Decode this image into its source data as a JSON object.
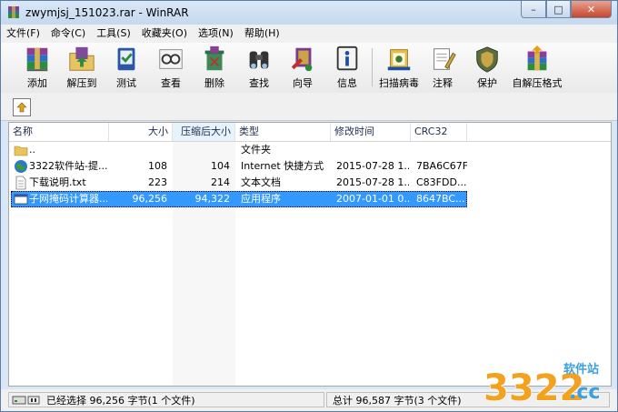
{
  "window": {
    "title": "zwymjsj_151023.rar - WinRAR"
  },
  "window_controls": {
    "minimize": "–",
    "maximize": "□",
    "close": "✕"
  },
  "menu": [
    "文件(F)",
    "命令(C)",
    "工具(S)",
    "收藏夹(O)",
    "选项(N)",
    "帮助(H)"
  ],
  "toolbar": {
    "add": "添加",
    "extract_to": "解压到",
    "test": "测试",
    "view": "查看",
    "delete": "删除",
    "find": "查找",
    "wizard": "向导",
    "info": "信息",
    "virus_scan": "扫描病毒",
    "comment": "注释",
    "protect": "保护",
    "sfx": "自解压格式"
  },
  "columns": {
    "name": "名称",
    "size": "大小",
    "packed": "压缩后大小",
    "type": "类型",
    "modified": "修改时间",
    "crc": "CRC32"
  },
  "files": [
    {
      "name": "..",
      "size": "",
      "packed": "",
      "type": "文件夹",
      "modified": "",
      "crc": "",
      "icon": "folder-icon"
    },
    {
      "name": "3322软件站-提...",
      "size": "108",
      "packed": "104",
      "type": "Internet 快捷方式",
      "modified": "2015-07-28 1...",
      "crc": "7BA6C67F",
      "icon": "globe-icon"
    },
    {
      "name": "下载说明.txt",
      "size": "223",
      "packed": "214",
      "type": "文本文档",
      "modified": "2015-07-28 1...",
      "crc": "C83FDD...",
      "icon": "text-file-icon"
    },
    {
      "name": "子网掩码计算器....",
      "size": "96,256",
      "packed": "94,322",
      "type": "应用程序",
      "modified": "2007-01-01 0...",
      "crc": "8647BC...",
      "icon": "app-icon"
    }
  ],
  "status": {
    "left": "已经选择 96,256 字节(1 个文件)",
    "right": "总计 96,587 字节(3 个文件)"
  },
  "watermark": {
    "number": "3322",
    "site_label": "软件站",
    "domain": ".cc"
  },
  "colors": {
    "selection": "#3399ff",
    "title_bg": "#c4d8ef",
    "close_button": "#c8452c"
  }
}
